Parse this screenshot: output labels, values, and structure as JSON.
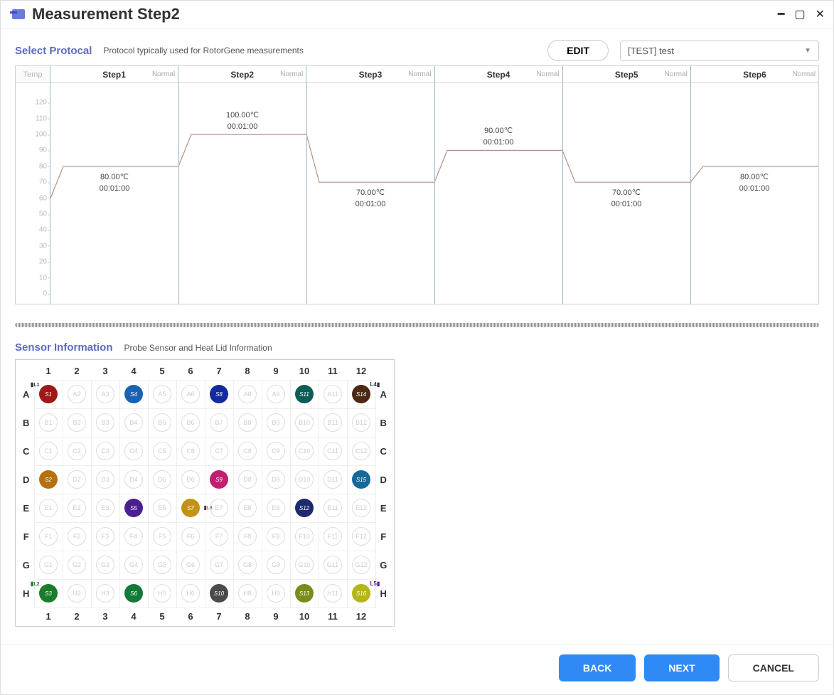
{
  "window": {
    "title": "Measurement Step2"
  },
  "protocol": {
    "title": "Select Protocal",
    "subtitle": "Protocol typically used for RotorGene measurements",
    "edit_label": "EDIT",
    "dropdown_value": "[TEST] test"
  },
  "chart_data": {
    "type": "line",
    "ylabel": "Temp",
    "ylim": [
      0,
      125
    ],
    "yticks": [
      0,
      10,
      20,
      30,
      40,
      50,
      60,
      70,
      80,
      90,
      100,
      110,
      120
    ],
    "steps": [
      {
        "name": "Step1",
        "status": "Normal",
        "temp_c": 80.0,
        "time": "00:01:00",
        "start_c": 60
      },
      {
        "name": "Step2",
        "status": "Normal",
        "temp_c": 100.0,
        "time": "00:01:00",
        "start_c": 80
      },
      {
        "name": "Step3",
        "status": "Normal",
        "temp_c": 70.0,
        "time": "00:01:00",
        "start_c": 100
      },
      {
        "name": "Step4",
        "status": "Normal",
        "temp_c": 90.0,
        "time": "00:01:00",
        "start_c": 70
      },
      {
        "name": "Step5",
        "status": "Normal",
        "temp_c": 70.0,
        "time": "00:01:00",
        "start_c": 90
      },
      {
        "name": "Step6",
        "status": "Normal",
        "temp_c": 80.0,
        "time": "00:01:00",
        "start_c": 70
      }
    ]
  },
  "sensor": {
    "title": "Sensor Information",
    "subtitle": "Probe Sensor and Heat Lid Information",
    "columns": [
      "1",
      "2",
      "3",
      "4",
      "5",
      "6",
      "7",
      "8",
      "9",
      "10",
      "11",
      "12"
    ],
    "rows": [
      "A",
      "B",
      "C",
      "D",
      "E",
      "F",
      "G",
      "H"
    ],
    "lid_marks": [
      {
        "label": "L1",
        "row": "A",
        "side": "left"
      },
      {
        "label": "L2",
        "row": "H",
        "side": "left"
      },
      {
        "label": "L3",
        "row": "E",
        "col": 7,
        "side": "inner"
      },
      {
        "label": "L4",
        "row": "A",
        "side": "right"
      },
      {
        "label": "L5",
        "row": "H",
        "side": "right"
      }
    ],
    "filled_wells": [
      {
        "row": "A",
        "col": 1,
        "label": "S1",
        "color": "#a01818"
      },
      {
        "row": "A",
        "col": 4,
        "label": "S4",
        "color": "#1a62b3"
      },
      {
        "row": "A",
        "col": 7,
        "label": "S8",
        "color": "#112a9e"
      },
      {
        "row": "A",
        "col": 10,
        "label": "S11",
        "color": "#0d5c56"
      },
      {
        "row": "A",
        "col": 12,
        "label": "S14",
        "color": "#4b2a14"
      },
      {
        "row": "D",
        "col": 1,
        "label": "S2",
        "color": "#b5710f"
      },
      {
        "row": "D",
        "col": 7,
        "label": "S9",
        "color": "#c21f6e"
      },
      {
        "row": "D",
        "col": 12,
        "label": "S15",
        "color": "#156a99"
      },
      {
        "row": "E",
        "col": 4,
        "label": "S5",
        "color": "#4b1e92"
      },
      {
        "row": "E",
        "col": 6,
        "label": "S7",
        "color": "#c39317"
      },
      {
        "row": "E",
        "col": 10,
        "label": "S12",
        "color": "#1d2a6e"
      },
      {
        "row": "H",
        "col": 1,
        "label": "S3",
        "color": "#1b7d2a"
      },
      {
        "row": "H",
        "col": 4,
        "label": "S6",
        "color": "#147a38"
      },
      {
        "row": "H",
        "col": 7,
        "label": "S10",
        "color": "#4a4a4a"
      },
      {
        "row": "H",
        "col": 10,
        "label": "S13",
        "color": "#7b8a1a"
      },
      {
        "row": "H",
        "col": 12,
        "label": "S16",
        "color": "#b5b51a"
      }
    ]
  },
  "footer": {
    "back": "BACK",
    "next": "NEXT",
    "cancel": "CANCEL"
  }
}
